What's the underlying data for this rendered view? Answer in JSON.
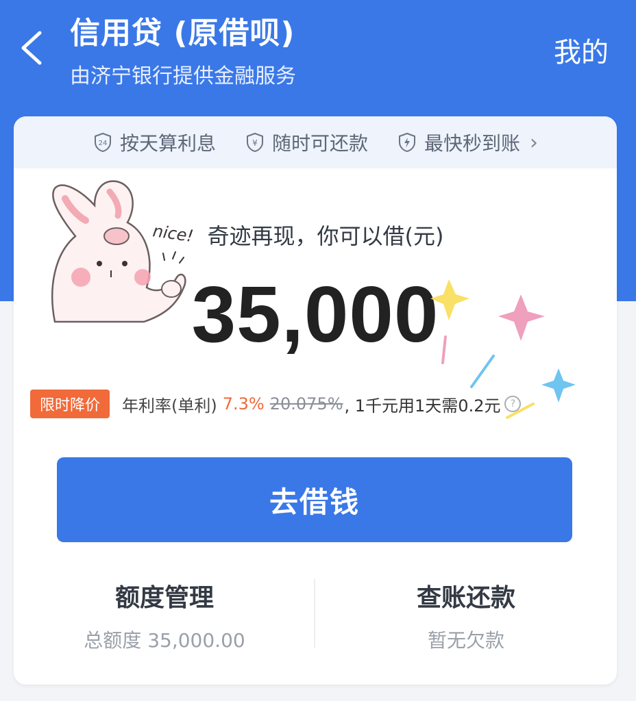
{
  "header": {
    "title": "信用贷 (原借呗)",
    "subtitle": "由济宁银行提供金融服务",
    "mine_label": "我的"
  },
  "features": [
    {
      "label": "按天算利息",
      "icon": "clock-24-shield-icon"
    },
    {
      "label": "随时可还款",
      "icon": "yen-shield-icon"
    },
    {
      "label": "最快秒到账",
      "icon": "lightning-shield-icon"
    }
  ],
  "loan": {
    "headline": "奇迹再现，你可以借(元)",
    "amount": "35,000"
  },
  "rate": {
    "badge": "限时降价",
    "label": "年利率(单利)",
    "value": "7.3%",
    "old_value": "20.075%",
    "desc": ", 1千元用1天需0.2元",
    "info_icon": "info-icon"
  },
  "borrow_button": "去借钱",
  "bottom": {
    "left_title": "额度管理",
    "left_sub": "总额度 35,000.00",
    "right_title": "查账还款",
    "right_sub": "暂无欠款"
  },
  "sticker": {
    "text": "nice!"
  },
  "colors": {
    "brand_blue": "#3a78e8",
    "accent_orange": "#f06a3a"
  }
}
